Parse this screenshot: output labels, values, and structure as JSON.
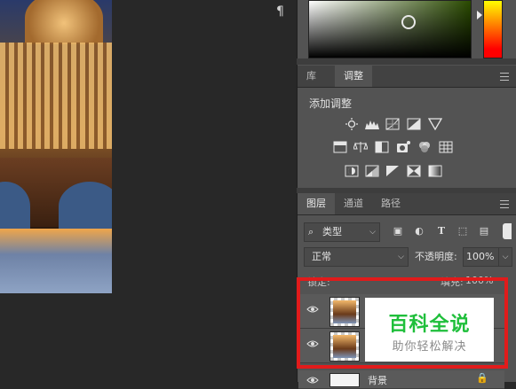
{
  "toolbar_strip": {
    "paragraph_icon": "¶"
  },
  "panels": {
    "adjust_tabs": [
      {
        "label": "库",
        "active": false
      },
      {
        "label": "调整",
        "active": true
      }
    ],
    "adjust_title": "添加调整",
    "adjust_icons": [
      [
        "brightness-icon",
        "levels-icon",
        "curves-icon",
        "exposure-icon",
        "vibrance-icon"
      ],
      [
        "hue-saturation-icon",
        "color-balance-icon",
        "black-white-icon",
        "photo-filter-icon",
        "channel-mixer-icon",
        "color-lookup-icon"
      ],
      [
        "invert-icon",
        "posterize-icon",
        "threshold-icon",
        "selective-color-icon",
        "gradient-map-icon"
      ]
    ],
    "layers_tabs": [
      {
        "label": "图层",
        "active": true
      },
      {
        "label": "通道",
        "active": false
      },
      {
        "label": "路径",
        "active": false
      }
    ],
    "filter": {
      "label": "类型",
      "icon": "search-icon"
    },
    "filter_icons": [
      "pixel-filter-icon",
      "adjustment-filter-icon",
      "type-filter-icon",
      "shape-filter-icon",
      "smart-object-filter-icon"
    ],
    "blend_mode": "正常",
    "opacity_label": "不透明度:",
    "opacity_value": "100%",
    "lock_label": "锁定:",
    "fill_label": "填充:",
    "fill_value": "100%",
    "layers": [
      {
        "name": "",
        "visible": true
      },
      {
        "name": "",
        "visible": true
      },
      {
        "name": "背景",
        "visible": true,
        "locked": true
      }
    ]
  },
  "watermark": {
    "title": "百科全说",
    "subtitle": "助你轻松解决"
  },
  "colors": {
    "panel_bg": "#535353",
    "highlight": "#e11b1b",
    "watermark_green": "#1fbf3b"
  }
}
